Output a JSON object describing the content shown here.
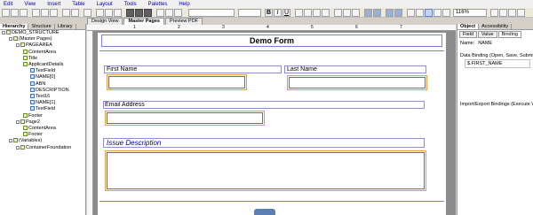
{
  "menu": [
    "Edit",
    "View",
    "Insert",
    "Table",
    "Layout",
    "Tools",
    "Palettes",
    "Help"
  ],
  "toolbar": {
    "zoom": "116%"
  },
  "hierarchy": {
    "tabs": [
      "Hierarchy",
      "Structure",
      "Library"
    ],
    "tree": [
      {
        "label": "DEMO_STRUCTURE",
        "depth": 0,
        "icon": "form-icon"
      },
      {
        "label": "(Master Pages)",
        "depth": 1,
        "icon": "master-pages-icon"
      },
      {
        "label": "PAGEAREA",
        "depth": 2,
        "icon": "page-icon"
      },
      {
        "label": "ContentArea",
        "depth": 3,
        "icon": "content-area-icon"
      },
      {
        "label": "Title",
        "depth": 3,
        "icon": "text-icon"
      },
      {
        "label": "ApplicantDetails",
        "depth": 3,
        "icon": "subform-icon"
      },
      {
        "label": "TextField",
        "depth": 4,
        "icon": "textfield-icon"
      },
      {
        "label": "NAME[0]",
        "depth": 4,
        "icon": "textfield-icon"
      },
      {
        "label": "ABN",
        "depth": 4,
        "icon": "textfield-icon"
      },
      {
        "label": "DESCRIPTION",
        "depth": 4,
        "icon": "textfield-icon"
      },
      {
        "label": "Text16",
        "depth": 4,
        "icon": "text-icon"
      },
      {
        "label": "NAME[1]",
        "depth": 4,
        "icon": "textfield-icon"
      },
      {
        "label": "TextField",
        "depth": 4,
        "icon": "textfield-icon"
      },
      {
        "label": "Footer",
        "depth": 3,
        "icon": "footer-icon"
      },
      {
        "label": "Page2",
        "depth": 2,
        "icon": "page-icon"
      },
      {
        "label": "ContentArea",
        "depth": 3,
        "icon": "content-area-icon"
      },
      {
        "label": "Footer",
        "depth": 3,
        "icon": "footer-icon"
      },
      {
        "label": "(Variables)",
        "depth": 1,
        "icon": "variables-icon"
      },
      {
        "label": "ContainerFoundation",
        "depth": 2,
        "icon": "script-icon"
      }
    ]
  },
  "doc_tabs": [
    "Design View",
    "Master Pages",
    "Preview PDF"
  ],
  "doc_tabs_active": "Master Pages",
  "ruler": [
    "1",
    "2",
    "3",
    "4",
    "5",
    "6",
    "7"
  ],
  "form": {
    "title": "Demo Form",
    "first_name": "First Name",
    "last_name": "Last Name",
    "email": "Email Address",
    "issue": "Issue  Description"
  },
  "object_panel": {
    "tabs": [
      "Object",
      "Accessibility"
    ],
    "subtabs": [
      "Field",
      "Value",
      "Binding"
    ],
    "name_label": "Name:",
    "name_value": "NAME",
    "data_binding_label": "Data Binding (Open, Save, Submit):",
    "data_binding_value": "$.FIRST_NAME",
    "import_export_label": "Import/Export Bindings (Execute WSD"
  },
  "colors": {
    "form_title": "#000000",
    "issue_label": "#00008b",
    "field_border": "#9090d0",
    "field_selected": "#e0a040"
  }
}
